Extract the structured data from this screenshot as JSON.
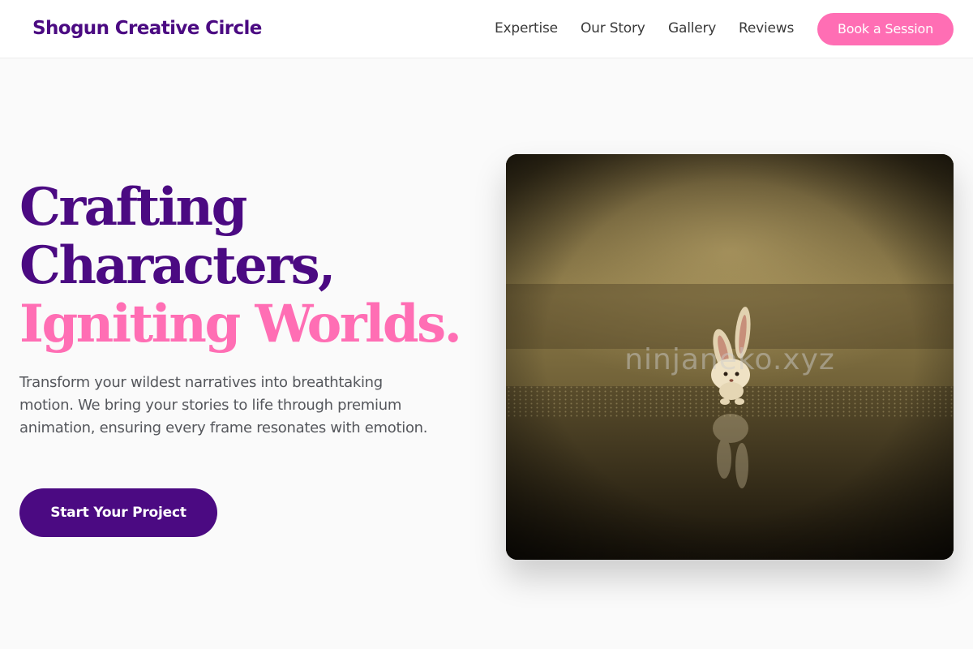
{
  "header": {
    "brand": "Shogun Creative Circle",
    "nav": [
      "Expertise",
      "Our Story",
      "Gallery",
      "Reviews"
    ],
    "cta_label": "Book a Session"
  },
  "hero": {
    "title_line_1": "Crafting",
    "title_line_2": "Characters,",
    "title_line_3": "Igniting Worlds.",
    "description": "Transform your wildest narratives into breathtaking motion. We bring your stories to life through premium animation, ensuring every frame resonates with emotion.",
    "button_label": "Start Your Project",
    "image_watermark": "ninjaneko.xyz"
  },
  "colors": {
    "brand_purple": "#4b0a82",
    "accent_pink": "#ff6eb4",
    "page_background": "#fafafa"
  }
}
